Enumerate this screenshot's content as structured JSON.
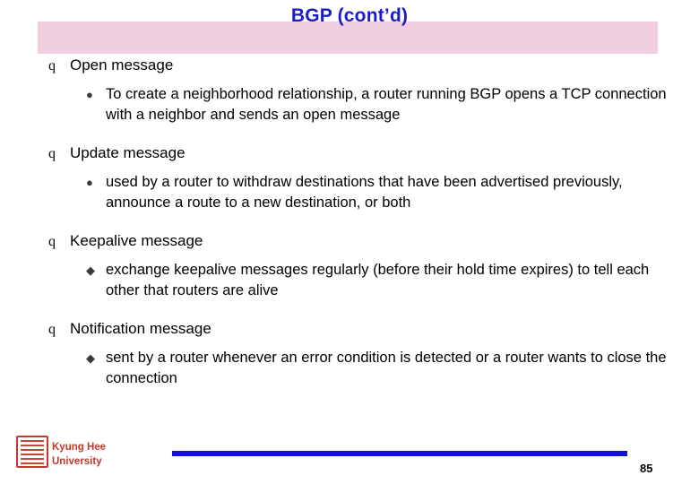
{
  "slide": {
    "title": "BGP (cont’d)",
    "title_color": "#1b1bcc",
    "title_band_color": "#f2cfe0",
    "bullets": [
      {
        "level1_marker": "q",
        "level1": "Open message",
        "level2_marker": "●",
        "level2": "To create a neighborhood relationship, a router running BGP opens a TCP connection with a neighbor and sends an open message"
      },
      {
        "level1_marker": "q",
        "level1": "Update message",
        "level2_marker": "●",
        "level2": "used by a router to withdraw destinations that have been advertised previously, announce a route to a new destination, or both"
      },
      {
        "level1_marker": "q",
        "level1": "Keepalive message",
        "level2_marker": "◆",
        "level2": "exchange keepalive messages regularly (before their hold time expires) to tell each other that routers are alive"
      },
      {
        "level1_marker": "q",
        "level1": "Notification message",
        "level2_marker": "◆",
        "level2": "sent by a router whenever an error condition is detected or a router wants to close the connection"
      }
    ]
  },
  "footer": {
    "org_line1": "Kyung Hee",
    "org_line2": "University",
    "org_color": "#c23a2a",
    "rule_color": "#1414c8",
    "page_number": "85"
  }
}
